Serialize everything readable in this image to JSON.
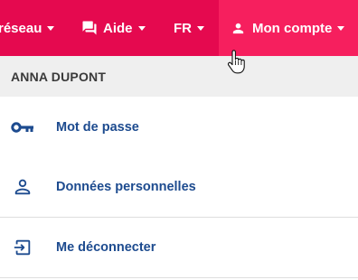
{
  "navbar": {
    "reseau_label": "réseau",
    "aide_label": "Aide",
    "lang_label": "FR",
    "account_label": "Mon compte"
  },
  "account_menu": {
    "user_name": "ANNA DUPONT",
    "items": [
      {
        "label": "Mot de passe",
        "icon": "key-icon"
      },
      {
        "label": "Données personnelles",
        "icon": "person-outline-icon"
      },
      {
        "label": "Me déconnecter",
        "icon": "logout-icon"
      }
    ]
  },
  "colors": {
    "navbar_bg": "#e5094f",
    "account_active_bg": "#f61f5e",
    "menu_text": "#1d4b8f",
    "header_bg": "#efefef"
  }
}
